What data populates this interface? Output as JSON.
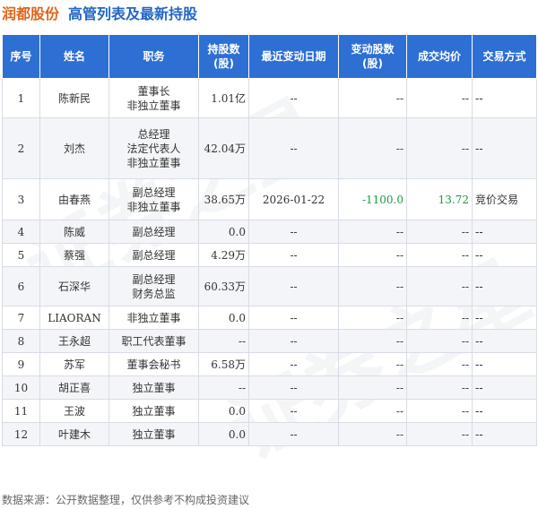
{
  "header": {
    "stock_name": "润都股份",
    "subtitle": "高管列表及最新持股"
  },
  "table": {
    "columns": [
      "序号",
      "姓名",
      "职务",
      "持股数\n(股)",
      "最近变动日期",
      "变动股数\n(股)",
      "成交均价",
      "交易方式"
    ],
    "rows": [
      {
        "no": "1",
        "name": "陈新民",
        "title": "董事长\n非独立董事",
        "shares": "1.01亿",
        "date": "--",
        "change": "--",
        "price": "--",
        "method": "--"
      },
      {
        "no": "2",
        "name": "刘杰",
        "title": "总经理\n法定代表人\n非独立董事",
        "shares": "42.04万",
        "date": "--",
        "change": "--",
        "price": "--",
        "method": "--"
      },
      {
        "no": "3",
        "name": "由春燕",
        "title": "副总经理\n非独立董事",
        "shares": "38.65万",
        "date": "2026-01-22",
        "change": "-1100.0",
        "price": "13.72",
        "method": "竞价交易"
      },
      {
        "no": "4",
        "name": "陈威",
        "title": "副总经理",
        "shares": "0.0",
        "date": "--",
        "change": "--",
        "price": "--",
        "method": "--"
      },
      {
        "no": "5",
        "name": "蔡强",
        "title": "副总经理",
        "shares": "4.29万",
        "date": "--",
        "change": "--",
        "price": "--",
        "method": "--"
      },
      {
        "no": "6",
        "name": "石深华",
        "title": "副总经理\n财务总监",
        "shares": "60.33万",
        "date": "--",
        "change": "--",
        "price": "--",
        "method": "--"
      },
      {
        "no": "7",
        "name": "LIAORAN",
        "title": "非独立董事",
        "shares": "0.0",
        "date": "--",
        "change": "--",
        "price": "--",
        "method": "--"
      },
      {
        "no": "8",
        "name": "王永超",
        "title": "职工代表董事",
        "shares": "--",
        "date": "--",
        "change": "--",
        "price": "--",
        "method": "--"
      },
      {
        "no": "9",
        "name": "苏军",
        "title": "董事会秘书",
        "shares": "6.58万",
        "date": "--",
        "change": "--",
        "price": "--",
        "method": "--"
      },
      {
        "no": "10",
        "name": "胡正喜",
        "title": "独立董事",
        "shares": "--",
        "date": "--",
        "change": "--",
        "price": "--",
        "method": "--"
      },
      {
        "no": "11",
        "name": "王波",
        "title": "独立董事",
        "shares": "0.0",
        "date": "--",
        "change": "--",
        "price": "--",
        "method": "--"
      },
      {
        "no": "12",
        "name": "叶建木",
        "title": "独立董事",
        "shares": "0.0",
        "date": "--",
        "change": "--",
        "price": "--",
        "method": "--"
      }
    ]
  },
  "footer": {
    "source": "数据来源：公开数据整理，仅供参考不构成投资建议"
  },
  "watermark": {
    "text": "证券之星"
  },
  "colors": {
    "header_bg": "#2e6fd4",
    "title_orange": "#e0641c",
    "title_blue": "#2166c4",
    "positive_green": "#1e9a3a"
  }
}
